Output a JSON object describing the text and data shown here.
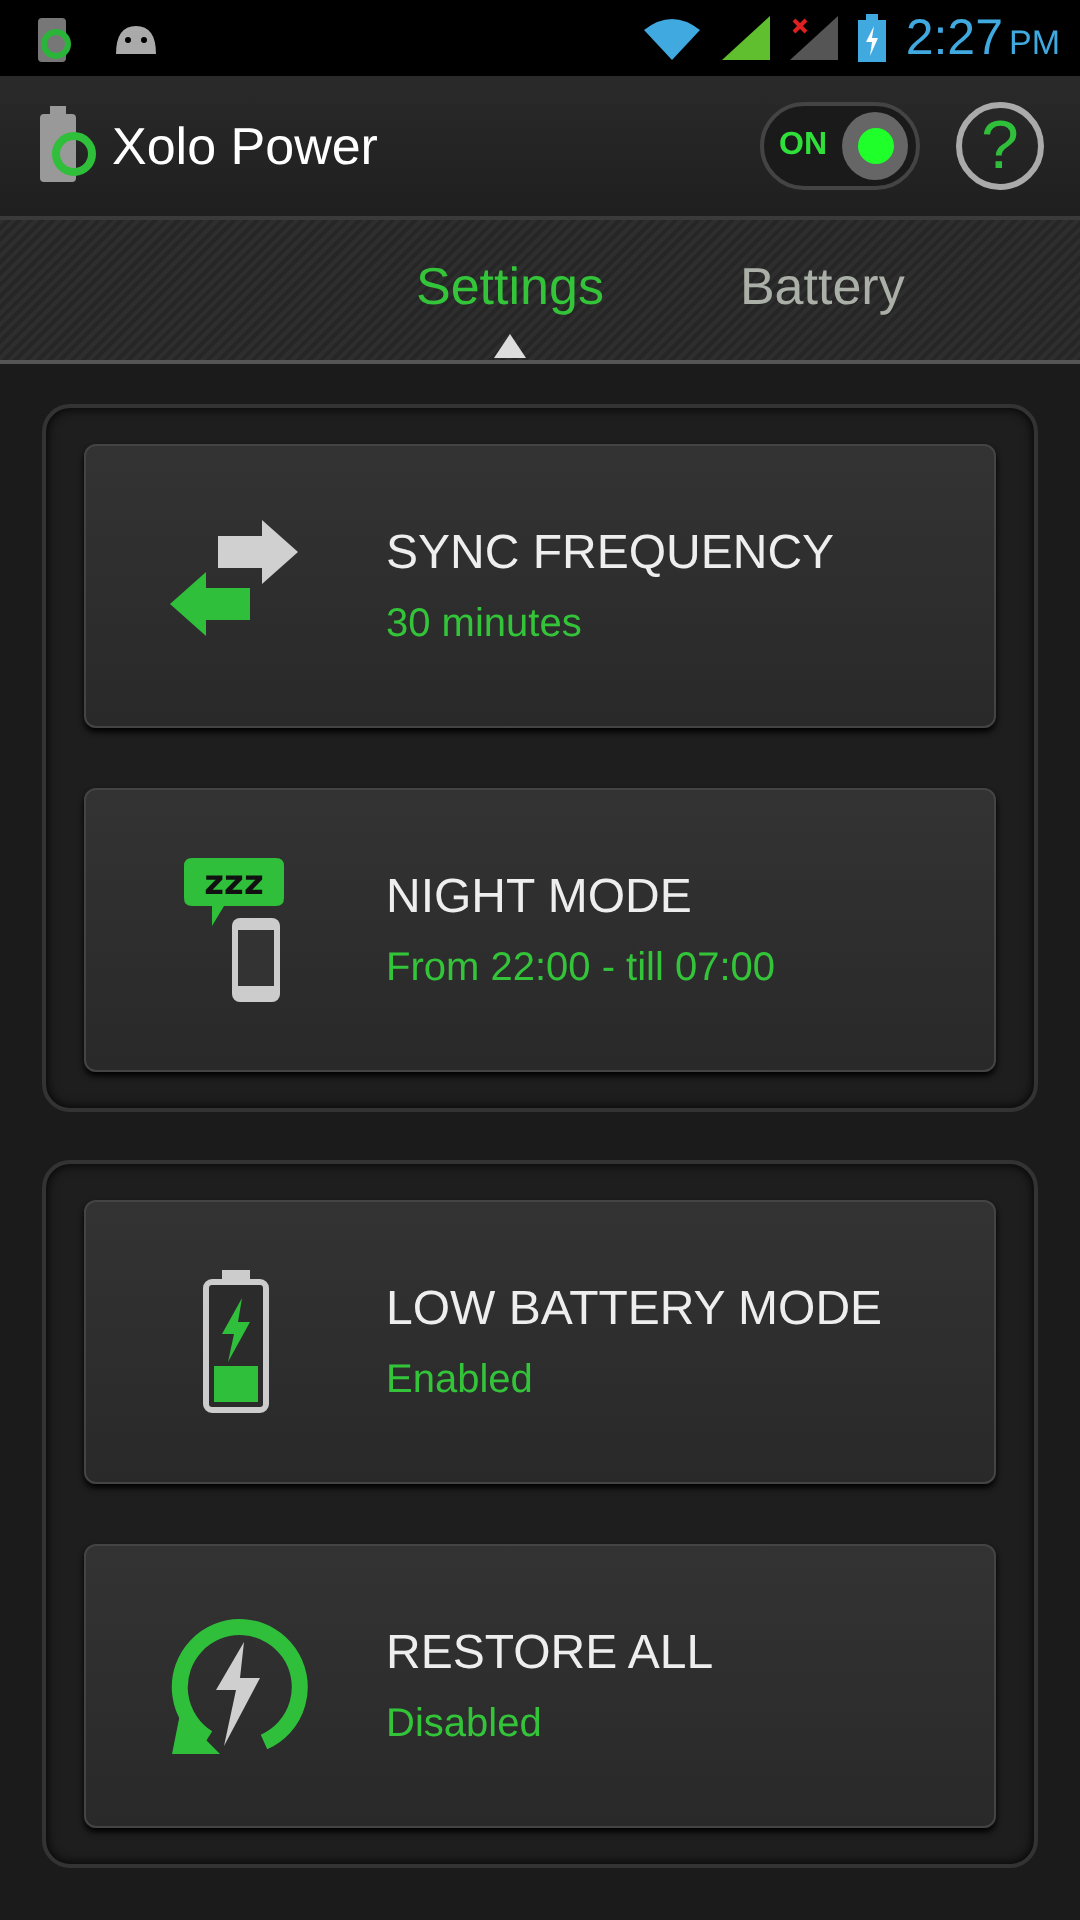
{
  "status_bar": {
    "time": "2:27",
    "ampm": "PM"
  },
  "header": {
    "title": "Xolo Power",
    "switch": {
      "label": "ON",
      "on": true
    },
    "help": "?"
  },
  "tabs": [
    {
      "label": "Settings",
      "selected": true
    },
    {
      "label": "Battery",
      "selected": false
    }
  ],
  "groups": [
    {
      "items": [
        {
          "kind": "sync",
          "title": "SYNC FREQUENCY",
          "value": "30 minutes"
        },
        {
          "kind": "night",
          "title": "NIGHT MODE",
          "value": "From 22:00 - till 07:00",
          "icon_text": "zzz"
        }
      ]
    },
    {
      "items": [
        {
          "kind": "battery",
          "title": "LOW BATTERY MODE",
          "value": "Enabled"
        },
        {
          "kind": "restore",
          "title": "RESTORE ALL",
          "value": "Disabled"
        }
      ]
    }
  ]
}
